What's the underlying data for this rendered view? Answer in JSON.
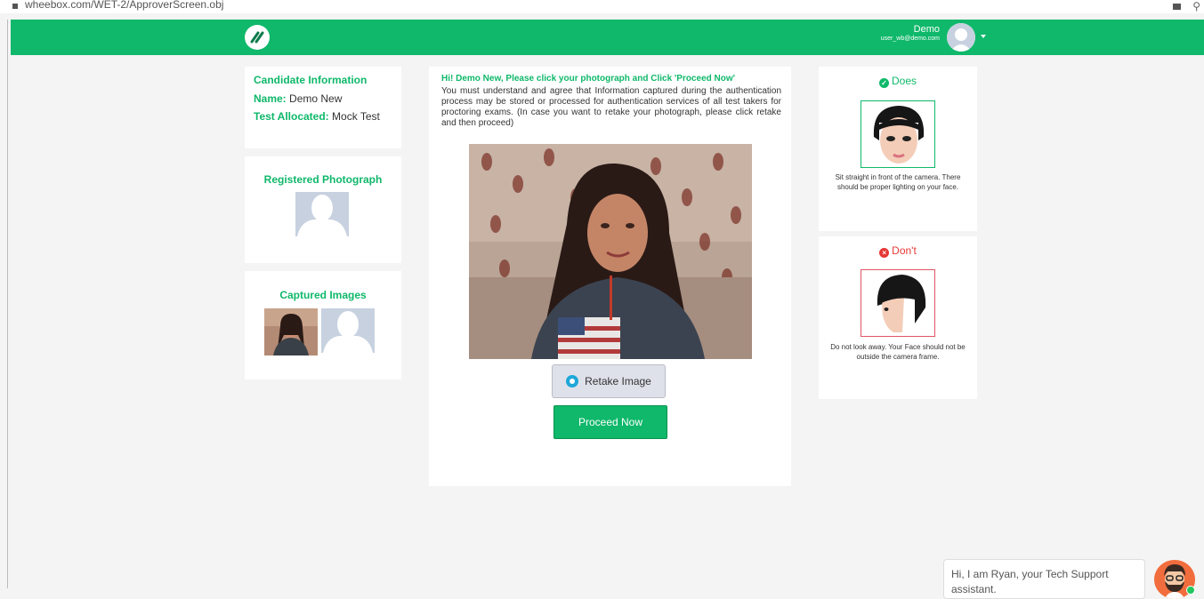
{
  "browser": {
    "url": "wheebox.com/WET-2/ApproverScreen.obj"
  },
  "header": {
    "user_name": "Demo",
    "user_email": "user_wb@demo.com",
    "brand_color": "#0fb86a"
  },
  "candidate": {
    "title": "Candidate Information",
    "name_label": "Name:",
    "name_value": "Demo New",
    "test_label": "Test Allocated:",
    "test_value": "Mock Test"
  },
  "registered_photo": {
    "title": "Registered Photograph"
  },
  "captured_images": {
    "title": "Captured Images"
  },
  "main": {
    "greeting": "Hi! Demo New, Please click your photograph and Click 'Proceed Now'",
    "description": "You must understand and agree that Information captured during the authentication process may be stored or processed for authentication services of all test takers for proctoring exams. (In case you want to retake your photograph, please click retake and then proceed)",
    "retake_label": "Retake Image",
    "proceed_label": "Proceed Now"
  },
  "does": {
    "title": "Does",
    "text": "Sit straight in front of the camera. There should be proper lighting on your face.",
    "color": "#0fb86a"
  },
  "donts": {
    "title": "Don't",
    "text": "Do not look away. Your Face should not be outside the camera frame.",
    "color": "#e53935"
  },
  "chat": {
    "message": "Hi, I am Ryan, your Tech Support assistant."
  }
}
